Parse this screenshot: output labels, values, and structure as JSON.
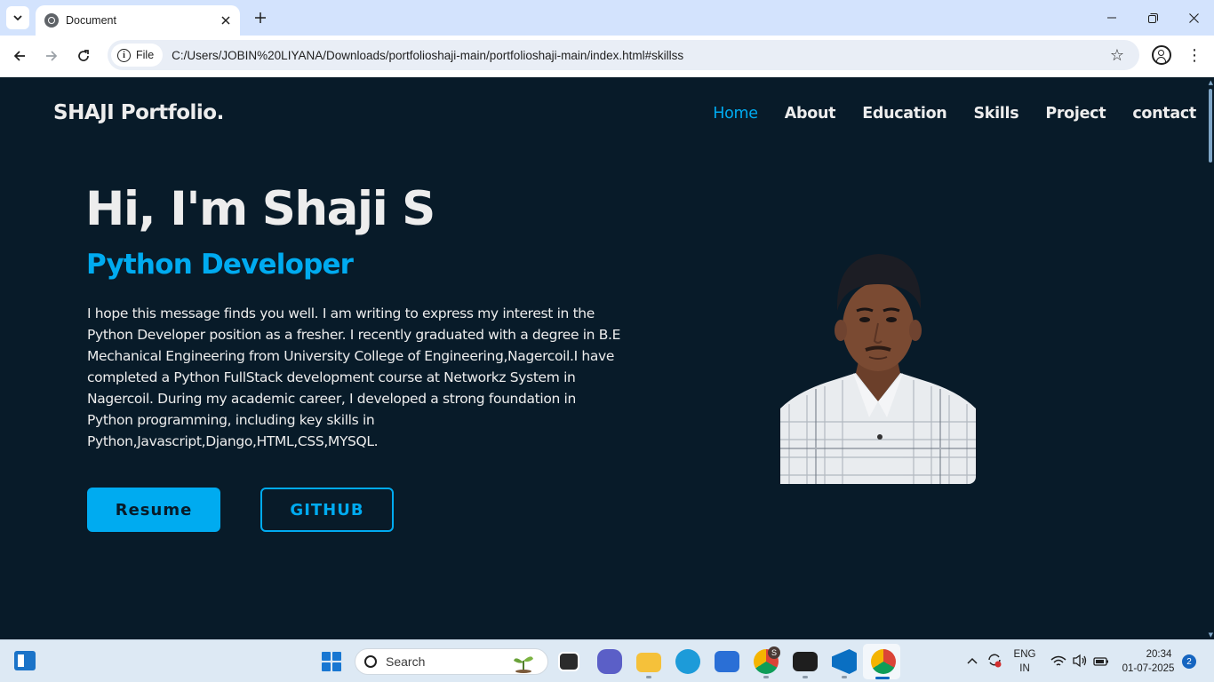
{
  "browser": {
    "tab_title": "Document",
    "site_chip": "File",
    "url": "C:/Users/JOBIN%20LIYANA/Downloads/portfolioshaji-main/portfolioshaji-main/index.html#skillss"
  },
  "page": {
    "logo": "SHAJI Portfolio.",
    "nav": [
      {
        "label": "Home",
        "active": true
      },
      {
        "label": "About"
      },
      {
        "label": "Education"
      },
      {
        "label": "Skills"
      },
      {
        "label": "Project"
      },
      {
        "label": "contact"
      }
    ],
    "hero": {
      "title": "Hi, I'm Shaji S",
      "subtitle": "Python Developer",
      "text": "I hope this message finds you well. I am writing to express my interest in the Python Developer position as a fresher. I recently graduated with a degree in B.E Mechanical Engineering from University College of Engineering,Nagercoil.I have completed a Python FullStack development course at Networkz System in Nagercoil. During my academic career, I developed a strong foundation in Python programming, including key skills in Python,Javascript,Django,HTML,CSS,MYSQL.",
      "resume_button": "Resume",
      "github_button": "GITHUB"
    },
    "colors": {
      "background": "#081b29",
      "accent": "#00abf0",
      "text": "#ededed"
    }
  },
  "taskbar": {
    "search_label": "Search",
    "language_top": "ENG",
    "language_bottom": "IN",
    "time": "20:34",
    "date": "01-07-2025",
    "notification_count": "2",
    "chrome_profile_badge": "S"
  }
}
